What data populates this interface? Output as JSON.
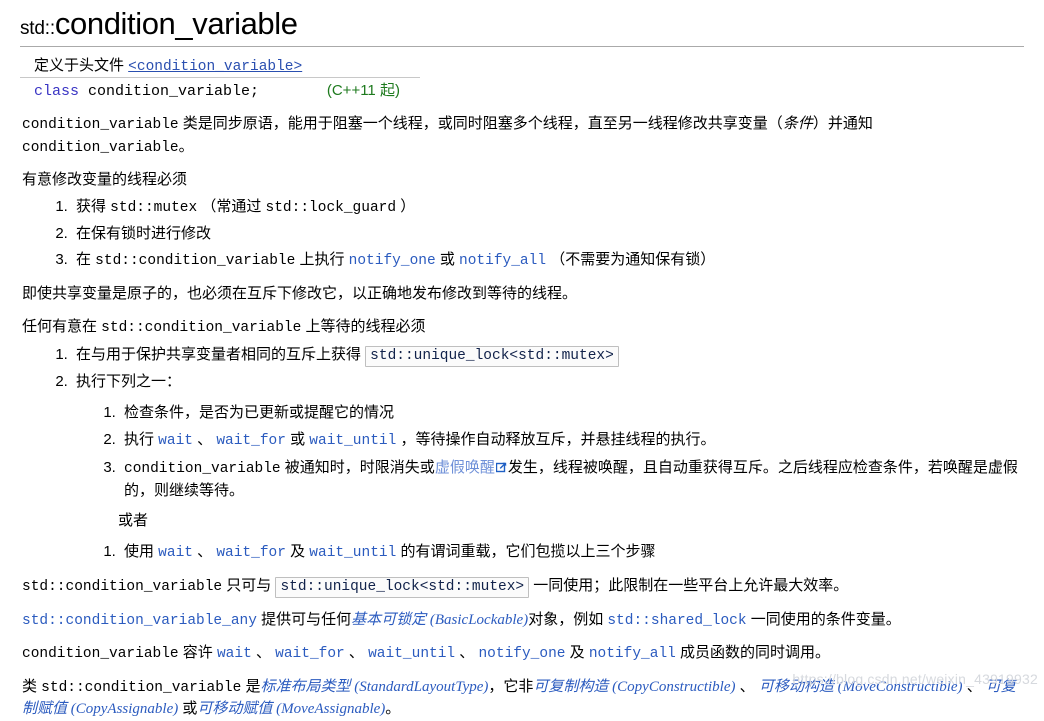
{
  "title": {
    "namespace": "std::",
    "name": "condition_variable"
  },
  "declaration": {
    "defined_in_label": "定义于头文件 ",
    "header_name": "<condition_variable>",
    "keyword": "class",
    "signature": " condition_variable;",
    "since": "(C++11 起)"
  },
  "intro": {
    "part1_code": "condition_variable",
    "part1_text": " 类是同步原语，能用于阻塞一个线程，或同时阻塞多个线程，直至另一线程修改共享变量（",
    "italic_condition": "条件",
    "part2_text": "）并通知 ",
    "part2_code": "condition_variable",
    "part3_text": "。"
  },
  "section1": {
    "lead": "有意修改变量的线程必须",
    "items": [
      {
        "t1": "获得 ",
        "c1": "std::mutex",
        "t2": " （常通过 ",
        "c2": "std::lock_guard",
        "t3": " ）"
      },
      {
        "t1": "在保有锁时进行修改"
      },
      {
        "t1": "在 ",
        "c1": "std::condition_variable",
        "t2": " 上执行 ",
        "link1": "notify_one",
        "t3": " 或 ",
        "link2": "notify_all",
        "t4": " （不需要为通知保有锁）"
      }
    ]
  },
  "note_atomic": "即使共享变量是原子的，也必须在互斥下修改它，以正确地发布修改到等待的线程。",
  "section2": {
    "lead_pre": "任何有意在 ",
    "lead_code": "std::condition_variable",
    "lead_post": " 上等待的线程必须",
    "item1_text": "在与用于保护共享变量者相同的互斥上获得 ",
    "item1_codebox": "std::unique_lock<std::mutex>",
    "item2_text": "执行下列之一：",
    "sub": {
      "s1": "检查条件，是否为已更新或提醒它的情况",
      "s2": {
        "t1": "执行 ",
        "l1": "wait",
        "t2": " 、 ",
        "l2": "wait_for",
        "t3": " 或 ",
        "l3": "wait_until",
        "t4": " ，等待操作自动释放互斥，并悬挂线程的执行。"
      },
      "s3": {
        "c1": "condition_variable",
        "t1": " 被通知时，时限消失或",
        "link": "虚假唤醒",
        "t2": "发生，线程被唤醒，且自动重获得互斥。之后线程应检查条件，若唤醒是虚假的，则继续等待。"
      }
    },
    "or_label": "或者",
    "alt": {
      "t1": "使用 ",
      "l1": "wait",
      "t2": " 、 ",
      "l2": "wait_for",
      "t3": " 及 ",
      "l3": "wait_until",
      "t4": " 的有谓词重载，它们包揽以上三个步骤"
    }
  },
  "para_unique_lock": {
    "c1": "std::condition_variable",
    "t1": " 只可与 ",
    "codebox": "std::unique_lock<std::mutex>",
    "t2": " 一同使用；此限制在一些平台上允许最大效率。"
  },
  "para_any": {
    "link1": "std::condition_variable_any",
    "t1": " 提供可与任何",
    "named1": "基本可锁定 (BasicLockable)",
    "t2": "对象，例如 ",
    "link2": "std::shared_lock",
    "t3": " 一同使用的条件变量。"
  },
  "para_concurrent": {
    "c1": "condition_variable",
    "t1": " 容许 ",
    "l1": "wait",
    "t2": " 、 ",
    "l2": "wait_for",
    "t3": " 、 ",
    "l3": "wait_until",
    "t4": " 、 ",
    "l4": "notify_one",
    "t5": " 及 ",
    "l5": "notify_all",
    "t6": " 成员函数的同时调用。"
  },
  "para_traits": {
    "t0": "类 ",
    "c1": "std::condition_variable",
    "t1": " 是",
    "n1": "标准布局类型 (StandardLayoutType)",
    "t2": "，它非",
    "n2": "可复制构造 (CopyConstructible)",
    "t3": " 、 ",
    "n3": "可移动构造 (MoveConstructible)",
    "t4": " 、 ",
    "n4": "可复制赋值 (CopyAssignable)",
    "t5": " 或",
    "n5": "可移动赋值 (MoveAssignable)",
    "t6": "。"
  },
  "watermark": "https://blog.csdn.net/weixin_43919932",
  "colors": {
    "link_blue": "#2b5bbf",
    "keyword_blue": "#3a35c4",
    "since_green": "#1e7a1e",
    "soft_link": "#6f90d8",
    "watermark": "#d6d9de"
  }
}
